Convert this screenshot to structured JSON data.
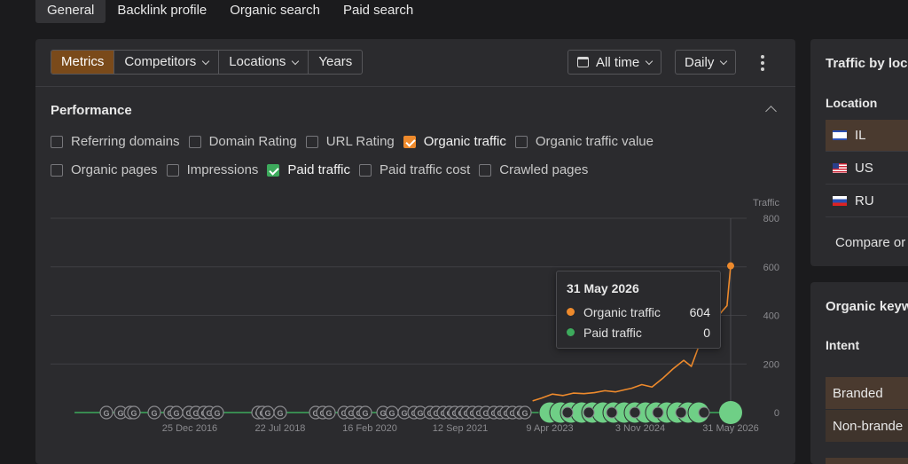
{
  "tabs": [
    "General",
    "Backlink profile",
    "Organic search",
    "Paid search"
  ],
  "toolbar": {
    "segments": [
      "Metrics",
      "Competitors",
      "Locations",
      "Years"
    ],
    "date_range": "All time",
    "granularity": "Daily"
  },
  "performance": {
    "title": "Performance",
    "row1": [
      {
        "label": "Referring domains",
        "checked": false
      },
      {
        "label": "Domain Rating",
        "checked": false
      },
      {
        "label": "URL Rating",
        "checked": false
      },
      {
        "label": "Organic traffic",
        "checked": true,
        "color": "#ee8a2c"
      },
      {
        "label": "Organic traffic value",
        "checked": false
      }
    ],
    "row2": [
      {
        "label": "Organic pages",
        "checked": false
      },
      {
        "label": "Impressions",
        "checked": false
      },
      {
        "label": "Paid traffic",
        "checked": true,
        "color": "#3daa5c"
      },
      {
        "label": "Paid traffic cost",
        "checked": false
      },
      {
        "label": "Crawled pages",
        "checked": false
      }
    ]
  },
  "chart_data": {
    "type": "line",
    "ylabel": "Traffic",
    "ylim": [
      0,
      800
    ],
    "y_ticks": [
      0,
      200,
      400,
      600,
      800
    ],
    "x_tick_labels": [
      "25 Dec 2016",
      "22 Jul 2018",
      "16 Feb 2020",
      "12 Sep 2021",
      "9 Apr 2023",
      "3 Nov 2024",
      "31 May 2026"
    ],
    "grid": true,
    "series": [
      {
        "name": "Organic traffic",
        "color": "#ee8a2c",
        "points": [
          [
            "2023-04-09",
            48
          ],
          [
            "2023-06-01",
            60
          ],
          [
            "2023-08-01",
            76
          ],
          [
            "2023-10-01",
            70
          ],
          [
            "2023-12-01",
            80
          ],
          [
            "2024-02-01",
            78
          ],
          [
            "2024-04-01",
            82
          ],
          [
            "2024-06-01",
            90
          ],
          [
            "2024-08-01",
            85
          ],
          [
            "2024-10-01",
            95
          ],
          [
            "2024-11-03",
            100
          ],
          [
            "2025-01-01",
            115
          ],
          [
            "2025-03-01",
            105
          ],
          [
            "2025-05-01",
            140
          ],
          [
            "2025-07-01",
            180
          ],
          [
            "2025-09-01",
            215
          ],
          [
            "2025-10-15",
            190
          ],
          [
            "2025-12-01",
            280
          ],
          [
            "2026-01-15",
            300
          ],
          [
            "2026-03-01",
            380
          ],
          [
            "2026-04-15",
            420
          ],
          [
            "2026-05-10",
            440
          ],
          [
            "2026-05-20",
            520
          ],
          [
            "2026-05-31",
            604
          ]
        ]
      },
      {
        "name": "Paid traffic",
        "color": "#3daa5c",
        "points": [
          [
            "2016-01-01",
            0
          ],
          [
            "2017-06-01",
            0
          ],
          [
            "2019-01-01",
            0
          ],
          [
            "2020-06-01",
            0
          ],
          [
            "2022-01-01",
            0
          ],
          [
            "2023-04-09",
            0
          ],
          [
            "2024-11-03",
            0
          ],
          [
            "2026-05-31",
            0
          ]
        ]
      }
    ],
    "tooltip": {
      "date": "31 May 2026",
      "rows": [
        {
          "label": "Organic traffic",
          "value": "604",
          "color": "#ee8a2c"
        },
        {
          "label": "Paid traffic",
          "value": "0",
          "color": "#3daa5c"
        }
      ]
    }
  },
  "right_top": {
    "title": "Traffic by loc",
    "column": "Location",
    "locations": [
      "IL",
      "US",
      "RU"
    ],
    "compare": "Compare or"
  },
  "right_bottom": {
    "title": "Organic keyw",
    "column": "Intent",
    "rows": [
      "Branded",
      "Non-brande"
    ]
  }
}
